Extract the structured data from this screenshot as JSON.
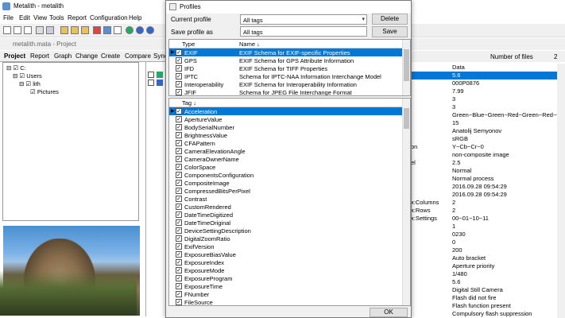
{
  "app": {
    "title": "Metalith - metalith",
    "menus": [
      "File",
      "Edit",
      "View",
      "Tools",
      "Report",
      "Configuration",
      "Help"
    ],
    "project_title": "metalith.mata - Project",
    "tabs": [
      "Project",
      "Report",
      "Graph",
      "Change",
      "Create",
      "Compare",
      "Sync"
    ],
    "tree": [
      {
        "label": "C:",
        "level": 0
      },
      {
        "label": "Users",
        "level": 1
      },
      {
        "label": "lith",
        "level": 2
      },
      {
        "label": "Pictures",
        "level": 3
      }
    ],
    "number_of_files_label": "Number of files",
    "number_of_files_value": "2",
    "right_header": "Data",
    "right_rows": [
      {
        "label": "",
        "value": "5.6",
        "selected": true
      },
      {
        "label": "",
        "value": "000P0876"
      },
      {
        "label": "",
        "value": "7.99"
      },
      {
        "label": "",
        "value": "3"
      },
      {
        "label": "",
        "value": "3"
      },
      {
        "label": "",
        "value": "Green~Blue~Green~Red~Green~Red~C"
      },
      {
        "label": "",
        "value": "15"
      },
      {
        "label": "",
        "value": "Anatolij Semyonov"
      },
      {
        "label": "",
        "value": "sRGB"
      },
      {
        "label": "on",
        "value": "Y~Cb~Cr~0"
      },
      {
        "label": "",
        "value": "non-composite image"
      },
      {
        "label": "el",
        "value": "2.5"
      },
      {
        "label": "",
        "value": "Normal"
      },
      {
        "label": "",
        "value": "Normal process"
      },
      {
        "label": "",
        "value": "2016.09.28 09:54:29"
      },
      {
        "label": "",
        "value": "2016.09.28 09:54:29"
      },
      {
        "label": "x:Columns",
        "value": "2"
      },
      {
        "label": "x:Rows",
        "value": "2"
      },
      {
        "label": "x:Settings",
        "value": "00~01~10~11"
      },
      {
        "label": "",
        "value": "1"
      },
      {
        "label": "",
        "value": "0230"
      },
      {
        "label": "",
        "value": "0"
      },
      {
        "label": "",
        "value": "200"
      },
      {
        "label": "",
        "value": "Auto bracket"
      },
      {
        "label": "",
        "value": "Aperture priority"
      },
      {
        "label": "",
        "value": "1/480"
      },
      {
        "label": "",
        "value": "5.6"
      },
      {
        "label": "",
        "value": "Digital Still Camera"
      },
      {
        "label": "",
        "value": "Flash did not fire"
      },
      {
        "label": "",
        "value": "Flash function present"
      },
      {
        "label": "",
        "value": "Compulsory flash suppression"
      }
    ]
  },
  "dialog": {
    "title": "Profiles",
    "current_profile_label": "Current profile",
    "current_profile_value": "All tags",
    "delete_label": "Delete",
    "save_as_label": "Save profile as",
    "save_as_value": "All tags",
    "save_label": "Save",
    "type_grid": {
      "col_type": "Type",
      "col_name": "Name",
      "sort_icon": "arrow-down",
      "rows": [
        {
          "type": "EXIF",
          "name": "EXIF Schema for EXIF-specific Properties",
          "selected": true
        },
        {
          "type": "GPS",
          "name": "EXIF Schema for GPS Attribute Information"
        },
        {
          "type": "IFD",
          "name": "EXIF Schema for TIFF Properties"
        },
        {
          "type": "IPTC",
          "name": "Schema for IPTC-NAA Information Interchange Model"
        },
        {
          "type": "Interoperability",
          "name": "EXIF Schema for Interoperability Information"
        },
        {
          "type": "JFIF",
          "name": "Schema for JPEG File Interchange Format"
        }
      ]
    },
    "tag_grid": {
      "col_tag": "Tag",
      "sort_icon": "arrow-down",
      "rows": [
        "Acceleration",
        "ApertureValue",
        "BodySerialNumber",
        "BrightnessValue",
        "CFAPattern",
        "CameraElevationAngle",
        "CameraOwnerName",
        "ColorSpace",
        "ComponentsConfiguration",
        "CompositeImage",
        "CompressedBitsPerPixel",
        "Contrast",
        "CustomRendered",
        "DateTimeDigitized",
        "DateTimeOriginal",
        "DeviceSettingDescription",
        "DigitalZoomRatio",
        "ExifVersion",
        "ExposureBiasValue",
        "ExposureIndex",
        "ExposureMode",
        "ExposureProgram",
        "ExposureTime",
        "FNumber",
        "FileSource"
      ]
    },
    "ok_label": "OK"
  }
}
